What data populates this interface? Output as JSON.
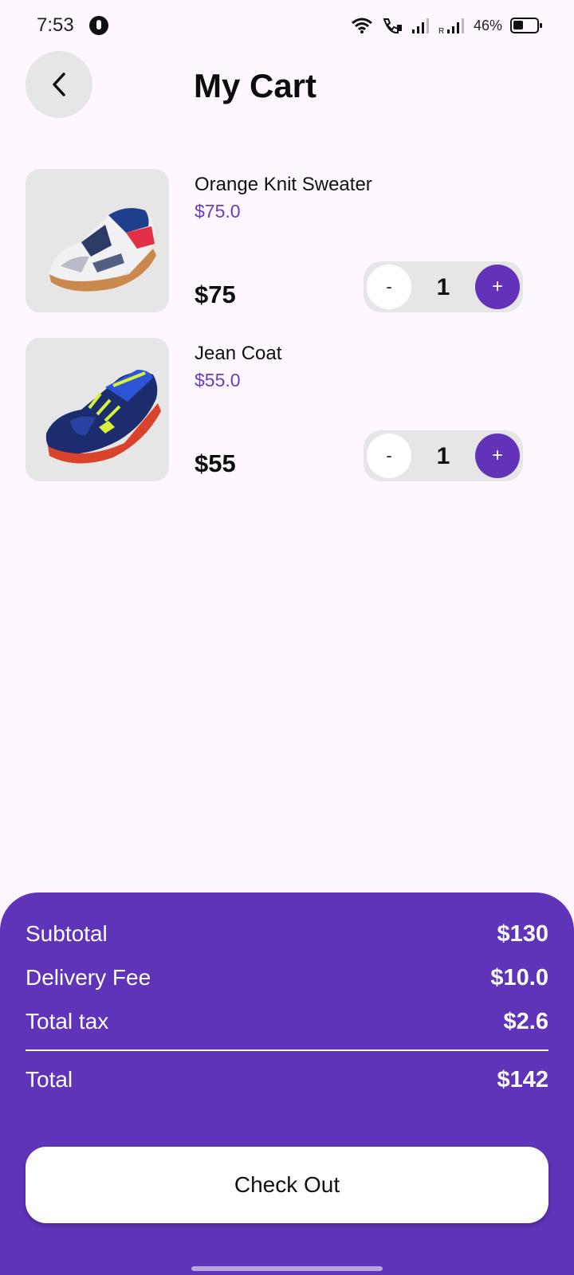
{
  "status_bar": {
    "time": "7:53",
    "battery_percent": "46%",
    "icons": [
      "app-notification-icon",
      "wifi-icon",
      "wifi-calling-icon",
      "signal-icon",
      "roaming-signal-icon",
      "battery-icon"
    ]
  },
  "header": {
    "title": "My Cart",
    "back_icon": "chevron-left-icon"
  },
  "cart": {
    "items": [
      {
        "name": "Orange Knit Sweater",
        "unit_price": "$75.0",
        "total": "$75",
        "quantity": "1",
        "minus_label": "-",
        "plus_label": "+",
        "image": "sneaker-white-red-navy"
      },
      {
        "name": "Jean Coat",
        "unit_price": "$55.0",
        "total": "$55",
        "quantity": "1",
        "minus_label": "-",
        "plus_label": "+",
        "image": "sneaker-navy-blue-neon"
      }
    ]
  },
  "summary": {
    "subtotal_label": "Subtotal",
    "subtotal_value": "$130",
    "delivery_label": "Delivery Fee",
    "delivery_value": "$10.0",
    "tax_label": "Total tax",
    "tax_value": "$2.6",
    "total_label": "Total",
    "total_value": "$142",
    "checkout_label": "Check Out"
  },
  "colors": {
    "accent": "#6034B9",
    "background": "#FEF7FF",
    "surface": "#E6E6E6",
    "price_text": "#6A3DC0"
  }
}
